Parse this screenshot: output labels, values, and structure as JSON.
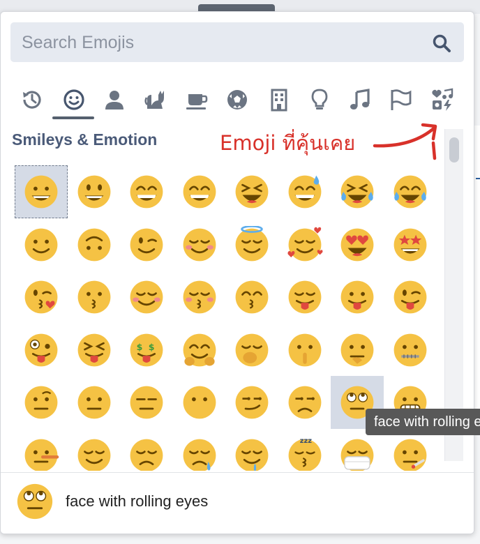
{
  "search": {
    "placeholder": "Search Emojis"
  },
  "categories": [
    {
      "name": "recent"
    },
    {
      "name": "smileys",
      "active": true
    },
    {
      "name": "people"
    },
    {
      "name": "animals"
    },
    {
      "name": "food"
    },
    {
      "name": "activities"
    },
    {
      "name": "places"
    },
    {
      "name": "objects"
    },
    {
      "name": "symbols"
    },
    {
      "name": "flags"
    },
    {
      "name": "custom"
    }
  ],
  "section": {
    "title": "Smileys & Emotion"
  },
  "annotation": {
    "text": "Emoji ที่คุ้นเคย",
    "color": "#d8312a"
  },
  "emoji_rows": [
    [
      "grinning",
      "smiley",
      "smile",
      "grin",
      "laughing",
      "sweat_smile",
      "rofl",
      "joy"
    ],
    [
      "slight_smile",
      "upside_down",
      "wink",
      "blush",
      "innocent",
      "smiling_hearts",
      "heart_eyes",
      "star_struck"
    ],
    [
      "kissing_heart",
      "kissing",
      "relaxed",
      "kissing_closed_eyes",
      "kissing_smiling_eyes",
      "yum",
      "stuck_out_tongue",
      "stuck_out_tongue_wink"
    ],
    [
      "zany",
      "stuck_out_tongue_closed",
      "money_mouth",
      "hugging",
      "hand_over_mouth",
      "shushing",
      "thinking",
      "zipper_mouth"
    ],
    [
      "raised_eyebrow",
      "neutral",
      "expressionless",
      "no_mouth",
      "smirk",
      "unamused",
      "rolling_eyes",
      "grimacing"
    ],
    [
      "lying",
      "relieved",
      "pensive",
      "sleepy",
      "drooling",
      "sleeping",
      "mask",
      "thermometer_face"
    ]
  ],
  "selected": "grinning",
  "hovered": "rolling_eyes",
  "tooltip": {
    "text": "face with rolling eyes"
  },
  "preview": {
    "name": "face with rolling eyes"
  }
}
